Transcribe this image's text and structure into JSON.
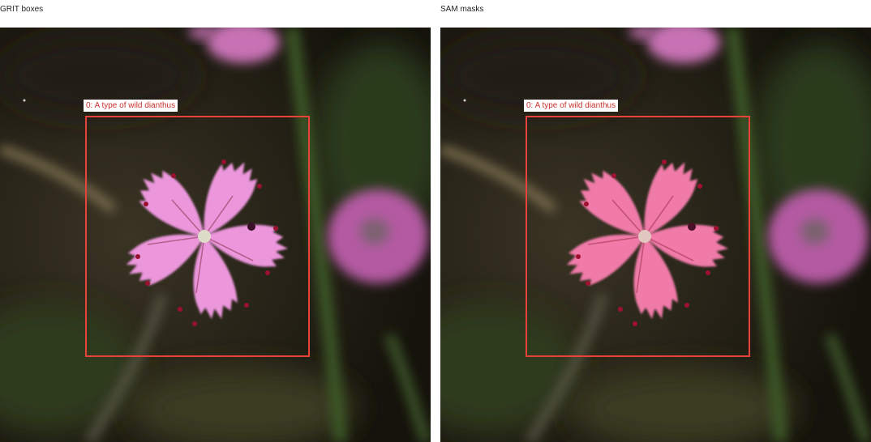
{
  "panels": [
    {
      "title": "GRIT boxes"
    },
    {
      "title": "SAM masks"
    }
  ],
  "detection": {
    "label": "0: A type of wild dianthus"
  },
  "colors": {
    "box_border": "#e8423a",
    "label_text": "#c8302a",
    "flower_natural": "#ec96dc",
    "flower_masked": "#f07aa8",
    "background_dark": "#1f1c13"
  }
}
